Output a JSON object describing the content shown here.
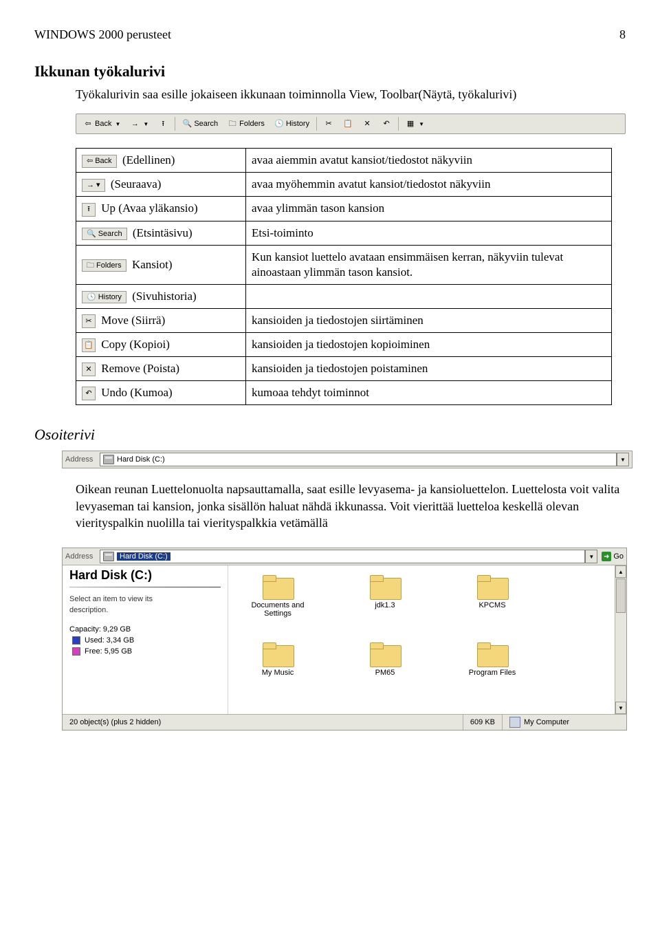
{
  "header": {
    "left": "WINDOWS 2000 perusteet",
    "page": "8"
  },
  "section1": {
    "title": "Ikkunan työkalurivi",
    "intro": "Työkalurivin saa esille jokaiseen ikkunaan toiminnolla View, Toolbar(Näytä, työkalurivi)"
  },
  "toolbar": {
    "back": "Back",
    "search": "Search",
    "folders": "Folders",
    "history": "History"
  },
  "table": {
    "rows": [
      {
        "btn": {
          "text": "Back",
          "style": "mini-btn",
          "glyph": "⇦"
        },
        "suffix": " (Edellinen)",
        "desc": "avaa aiemmin avatut kansiot/tiedostot näkyviin"
      },
      {
        "btn": {
          "text": "",
          "style": "mini-btn",
          "glyph": "→ ▾"
        },
        "suffix": " (Seuraava)",
        "desc": "avaa myöhemmin avatut kansiot/tiedostot näkyviin"
      },
      {
        "btn": {
          "text": "",
          "style": "mini-sq",
          "glyph": "⭱"
        },
        "suffix": " Up (Avaa yläkansio)",
        "desc": "avaa ylimmän tason kansion"
      },
      {
        "btn": {
          "text": "Search",
          "style": "mini-btn",
          "glyph": "🔍"
        },
        "suffix": " (Etsintäsivu)",
        "desc": "Etsi-toiminto"
      },
      {
        "btn": {
          "text": "Folders",
          "style": "mini-btn",
          "glyph": "🗀"
        },
        "suffix": " Kansiot)",
        "desc": "Kun kansiot luettelo avataan ensimmäisen kerran, näkyviin tulevat ainoastaan ylimmän tason kansiot."
      },
      {
        "btn": {
          "text": "History",
          "style": "mini-btn",
          "glyph": "🕓"
        },
        "suffix": " (Sivuhistoria)",
        "desc": ""
      },
      {
        "btn": {
          "text": "",
          "style": "mini-sq",
          "glyph": "✂"
        },
        "suffix": " Move (Siirrä)",
        "desc": "kansioiden ja tiedostojen siirtäminen"
      },
      {
        "btn": {
          "text": "",
          "style": "mini-sq",
          "glyph": "📋"
        },
        "suffix": " Copy (Kopioi)",
        "desc": "kansioiden ja tiedostojen kopioiminen"
      },
      {
        "btn": {
          "text": "",
          "style": "mini-sq",
          "glyph": "✕"
        },
        "suffix": " Remove (Poista)",
        "desc": "kansioiden ja tiedostojen poistaminen"
      },
      {
        "btn": {
          "text": "",
          "style": "mini-sq",
          "glyph": "↶"
        },
        "suffix": " Undo (Kumoa)",
        "desc": "kumoaa tehdyt toiminnot"
      }
    ]
  },
  "section2": {
    "title": "Osoiterivi",
    "address_label": "Address",
    "address_value": "Hard Disk (C:)",
    "para1": "Oikean reunan Luettelonuolta napsauttamalla, saat esille levyasema- ja kansioluettelon. Luettelosta voit valita levyaseman tai  kansion, jonka sisällön haluat nähdä ikkunassa. Voit vierittää luetteloa keskellä olevan vierityspalkin nuolilla tai vierityspalkkia vetämällä"
  },
  "screenshot": {
    "address_label": "Address",
    "address_value": "Hard Disk (C:)",
    "go": "Go",
    "disk_title": "Hard Disk (C:)",
    "sel_desc1": "Select an item to view its",
    "sel_desc2": "description.",
    "capacity": "Capacity: 9,29 GB",
    "used_label": "Used: 3,34 GB",
    "free_label": "Free: 5,95 GB",
    "folders": [
      "Documents and Settings",
      "jdk1.3",
      "KPCMS",
      "My Music",
      "PM65",
      "Program Files"
    ],
    "status_left": "20 object(s) (plus 2 hidden)",
    "status_mid": "609 KB",
    "status_right": "My Computer"
  }
}
